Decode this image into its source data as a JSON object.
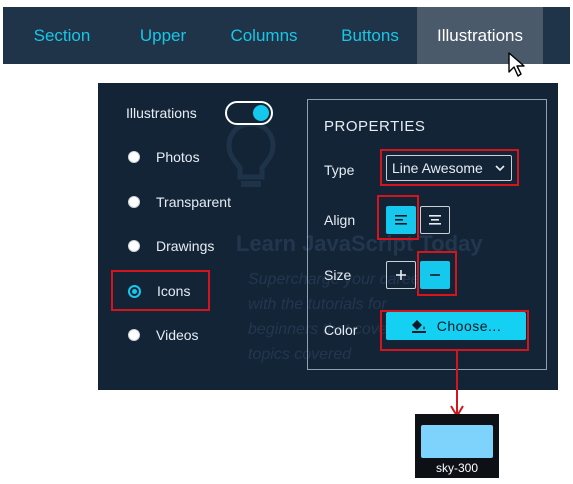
{
  "tabs": [
    {
      "label": "Section"
    },
    {
      "label": "Upper"
    },
    {
      "label": "Columns"
    },
    {
      "label": "Buttons"
    },
    {
      "label": "Illustrations",
      "active": true
    }
  ],
  "panel": {
    "toggle": {
      "label": "Illustrations",
      "on": true
    },
    "radios": [
      {
        "label": "Photos",
        "checked": false
      },
      {
        "label": "Transparent",
        "checked": false
      },
      {
        "label": "Drawings",
        "checked": false
      },
      {
        "label": "Icons",
        "checked": true
      },
      {
        "label": "Videos",
        "checked": false
      }
    ],
    "background_text": {
      "title": "Learn JavaScript Today",
      "lines": [
        "Supercharge your career",
        "with the tutorials for",
        "beginners that cover all",
        "topics covered"
      ]
    }
  },
  "properties": {
    "title": "PROPERTIES",
    "type_label": "Type",
    "type_value": "Line Awesome",
    "align_label": "Align",
    "size_label": "Size",
    "color_label": "Color",
    "choose_label": "Choose...",
    "align_selected": "left",
    "size_selected": "minus"
  },
  "swatch": {
    "label": "sky-300",
    "color": "#7dd3fc"
  },
  "colors": {
    "accent": "#14c8ee",
    "panel": "#142437",
    "tabbar": "#1f3449",
    "highlight": "#d5151d"
  }
}
